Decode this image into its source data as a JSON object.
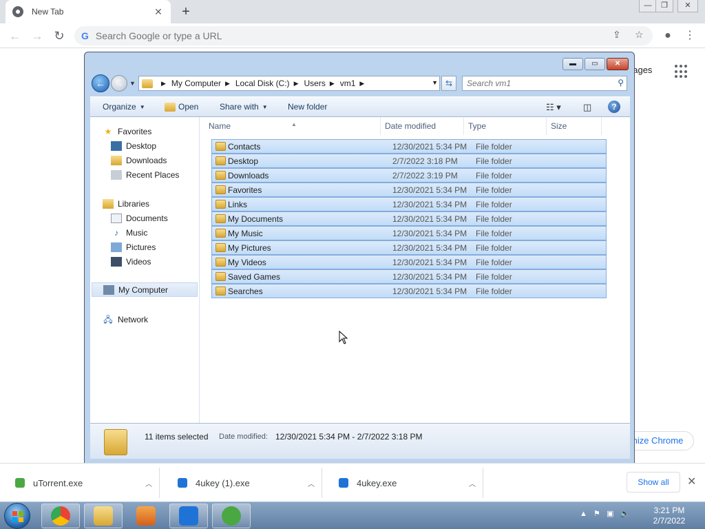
{
  "chrome": {
    "tab_title": "New Tab",
    "tab_close": "✕",
    "new_tab": "+",
    "omnibox_placeholder": "Search Google or type a URL",
    "page_images_label": "nages",
    "customize_label": "mize Chrome"
  },
  "explorer": {
    "breadcrumbs": [
      "My Computer",
      "Local Disk (C:)",
      "Users",
      "vm1"
    ],
    "search_placeholder": "Search vm1",
    "toolbar": {
      "organize": "Organize",
      "open": "Open",
      "share_with": "Share with",
      "new_folder": "New folder"
    },
    "nav": {
      "favorites": "Favorites",
      "desktop": "Desktop",
      "downloads": "Downloads",
      "recent_places": "Recent Places",
      "libraries": "Libraries",
      "documents": "Documents",
      "music": "Music",
      "pictures": "Pictures",
      "videos": "Videos",
      "my_computer": "My Computer",
      "network": "Network"
    },
    "columns": {
      "name": "Name",
      "date_modified": "Date modified",
      "type": "Type",
      "size": "Size"
    },
    "files": [
      {
        "name": "Contacts",
        "date": "12/30/2021 5:34 PM",
        "type": "File folder"
      },
      {
        "name": "Desktop",
        "date": "2/7/2022 3:18 PM",
        "type": "File folder"
      },
      {
        "name": "Downloads",
        "date": "2/7/2022 3:19 PM",
        "type": "File folder"
      },
      {
        "name": "Favorites",
        "date": "12/30/2021 5:34 PM",
        "type": "File folder"
      },
      {
        "name": "Links",
        "date": "12/30/2021 5:34 PM",
        "type": "File folder"
      },
      {
        "name": "My Documents",
        "date": "12/30/2021 5:34 PM",
        "type": "File folder"
      },
      {
        "name": "My Music",
        "date": "12/30/2021 5:34 PM",
        "type": "File folder"
      },
      {
        "name": "My Pictures",
        "date": "12/30/2021 5:34 PM",
        "type": "File folder"
      },
      {
        "name": "My Videos",
        "date": "12/30/2021 5:34 PM",
        "type": "File folder"
      },
      {
        "name": "Saved Games",
        "date": "12/30/2021 5:34 PM",
        "type": "File folder"
      },
      {
        "name": "Searches",
        "date": "12/30/2021 5:34 PM",
        "type": "File folder"
      }
    ],
    "status": {
      "count": "11 items selected",
      "date_label": "Date modified:",
      "date_value": "12/30/2021 5:34 PM - 2/7/2022 3:18 PM"
    }
  },
  "downloads": {
    "items": [
      {
        "name": "uTorrent.exe",
        "color": "#4aa843"
      },
      {
        "name": "4ukey (1).exe",
        "color": "#1f73d6"
      },
      {
        "name": "4ukey.exe",
        "color": "#1f73d6"
      }
    ],
    "show_all": "Show all"
  },
  "taskbar": {
    "time": "3:21 PM",
    "date": "2/7/2022"
  }
}
